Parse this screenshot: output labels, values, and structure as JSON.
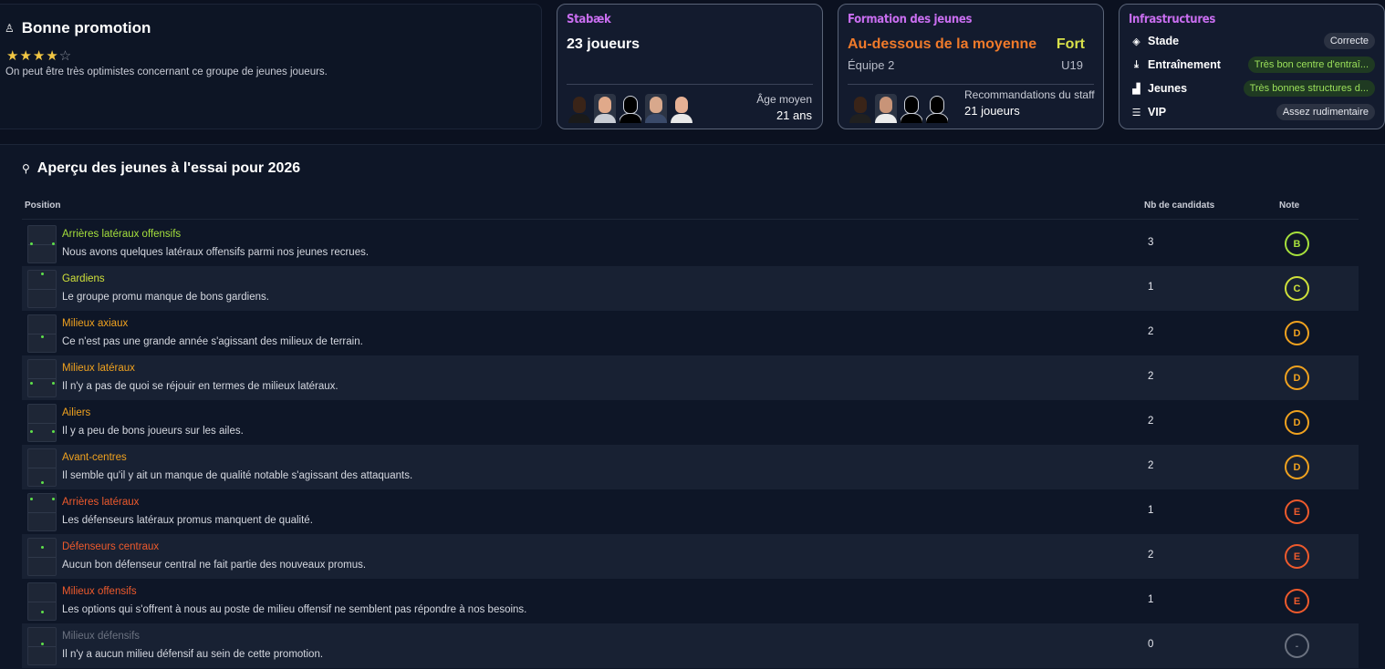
{
  "promotion": {
    "title": "Bonne promotion",
    "stars_filled": "★★★★",
    "stars_empty": "☆",
    "rating": 4,
    "rating_max": 5,
    "description": "On peut être très optimistes concernant ce groupe de jeunes joueurs."
  },
  "club_card": {
    "title": "Stabæk",
    "players": "23 joueurs",
    "avg_age_label": "Âge moyen",
    "avg_age_value": "21 ans"
  },
  "youth_card": {
    "title": "Formation des jeunes",
    "level": "Au-dessous de la moyenne",
    "strength": "Fort",
    "team": "Équipe 2",
    "age_group": "U19",
    "staff_label": "Recommandations du staff",
    "staff_value": "21 joueurs"
  },
  "infra_card": {
    "title": "Infrastructures",
    "rows": [
      {
        "icon": "stadium-icon",
        "label": "Stade",
        "value": "Correcte",
        "tone": "neutral"
      },
      {
        "icon": "training-icon",
        "label": "Entraînement",
        "value": "Très bon centre d'entraî...",
        "tone": "good"
      },
      {
        "icon": "youth-icon",
        "label": "Jeunes",
        "value": "Très bonnes structures d...",
        "tone": "good"
      },
      {
        "icon": "vip-icon",
        "label": "VIP",
        "value": "Assez rudimentaire",
        "tone": "neutral"
      }
    ]
  },
  "section": {
    "title": "Aperçu des jeunes à l'essai pour 2026",
    "col_position": "Position",
    "col_count": "Nb de candidats",
    "col_grade": "Note"
  },
  "colors": {
    "B": "#a6e03c",
    "C": "#cfe03a",
    "D": "#f0a21f",
    "E": "#ee5a2c",
    "none": "#6b7280"
  },
  "rows": [
    {
      "position": "Arrières latéraux offensifs",
      "desc": "Nous avons quelques latéraux offensifs parmi nos jeunes recrues.",
      "count": "3",
      "grade": "B"
    },
    {
      "position": "Gardiens",
      "desc": "Le groupe promu manque de bons gardiens.",
      "count": "1",
      "grade": "C"
    },
    {
      "position": "Milieux axiaux",
      "desc": "Ce n'est pas une grande année s'agissant des milieux de terrain.",
      "count": "2",
      "grade": "D"
    },
    {
      "position": "Milieux latéraux",
      "desc": "Il n'y a pas de quoi se réjouir en termes de milieux latéraux.",
      "count": "2",
      "grade": "D"
    },
    {
      "position": "Ailiers",
      "desc": "Il y a peu de bons joueurs sur les ailes.",
      "count": "2",
      "grade": "D"
    },
    {
      "position": "Avant-centres",
      "desc": "Il semble qu'il y ait un manque de qualité notable s'agissant des attaquants.",
      "count": "2",
      "grade": "D"
    },
    {
      "position": "Arrières latéraux",
      "desc": "Les défenseurs latéraux promus manquent de qualité.",
      "count": "1",
      "grade": "E"
    },
    {
      "position": "Défenseurs centraux",
      "desc": "Aucun bon défenseur central ne fait partie des nouveaux promus.",
      "count": "2",
      "grade": "E"
    },
    {
      "position": "Milieux offensifs",
      "desc": "Les options qui s'offrent à nous au poste de milieu offensif ne semblent pas répondre à nos besoins.",
      "count": "1",
      "grade": "E"
    },
    {
      "position": "Milieux défensifs",
      "desc": "Il n'y a aucun milieu défensif au sein de cette promotion.",
      "count": "0",
      "grade": "-"
    }
  ]
}
